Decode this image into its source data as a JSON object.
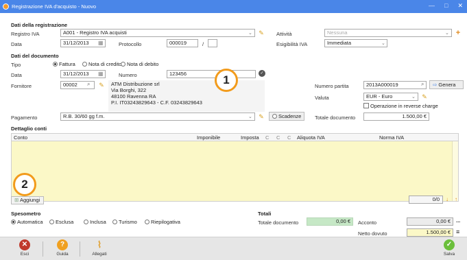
{
  "window": {
    "title": "Registrazione IVA d'acquisto - Nuovo",
    "minimize": "—",
    "maximize": "□",
    "close": "✕"
  },
  "registration": {
    "section": "Dati della registrazione",
    "registro_label": "Registro IVA",
    "registro_value": "A001 - Registro IVA acquisti",
    "data_label": "Data",
    "data_value": "31/12/2013",
    "protocollo_label": "Protocollo",
    "protocollo_value": "000019",
    "protocollo_sep": "/",
    "attivita_label": "Attività",
    "attivita_value": "Nessuna",
    "esigibilita_label": "Esigibilità IVA",
    "esigibilita_value": "Immediata"
  },
  "document": {
    "section": "Dati del documento",
    "tipo_label": "Tipo",
    "tipo_options": [
      "Fattura",
      "Nota di credito",
      "Nota di debito"
    ],
    "data_label": "Data",
    "data_value": "31/12/2013",
    "numero_label": "Numero",
    "numero_value": "123456",
    "fornitore_label": "Fornitore",
    "fornitore_code": "00002",
    "supplier_lines": [
      "ATM Distribuzione srl",
      "Via Borghi, 322",
      "48100 Ravenna RA",
      "P.I. IT03243829643 - C.F. 03243829643"
    ],
    "numero_partita_label": "Numero partita",
    "numero_partita_value": "2013A000019",
    "genera_label": "Genera",
    "valuta_label": "Valuta",
    "valuta_value": "EUR - Euro",
    "reverse_charge_label": "Operazione in reverse charge",
    "pagamento_label": "Pagamento",
    "pagamento_value": "R.B. 30/60 gg f.m.",
    "scadenze_label": "Scadenze",
    "totale_label": "Totale documento",
    "totale_value": "1.500,00 €"
  },
  "grid": {
    "section": "Dettaglio conti",
    "columns": [
      "Conto",
      "Imponibile",
      "Imposta",
      "C",
      "C",
      "C",
      "Aliquota IVA",
      "Norma IVA"
    ],
    "add_label": "Aggiungi",
    "pager": "0/0"
  },
  "spesometro": {
    "section": "Spesometro",
    "options": [
      "Automatica",
      "Esclusa",
      "Inclusa",
      "Turismo",
      "Riepilogativa"
    ]
  },
  "totals": {
    "section": "Totali",
    "totale_documento_label": "Totale documento",
    "totale_documento_value": "0,00 €",
    "acconto_label": "Acconto",
    "acconto_value": "0,00 €",
    "acconto_more": "...",
    "netto_label": "Netto dovuto",
    "netto_value": "1.500,00 €"
  },
  "callouts": [
    "1",
    "2"
  ],
  "footer": {
    "esci": "Esci",
    "guida": "Guida",
    "allegati": "Allegati",
    "salva": "Salva"
  },
  "colors": {
    "titlebar": "#4a86e8",
    "grid_bg": "#fbf8c7",
    "accent": "#f29b1c",
    "totale_bg": "#c6e8c6",
    "netto_bg": "#fbf8c7"
  }
}
